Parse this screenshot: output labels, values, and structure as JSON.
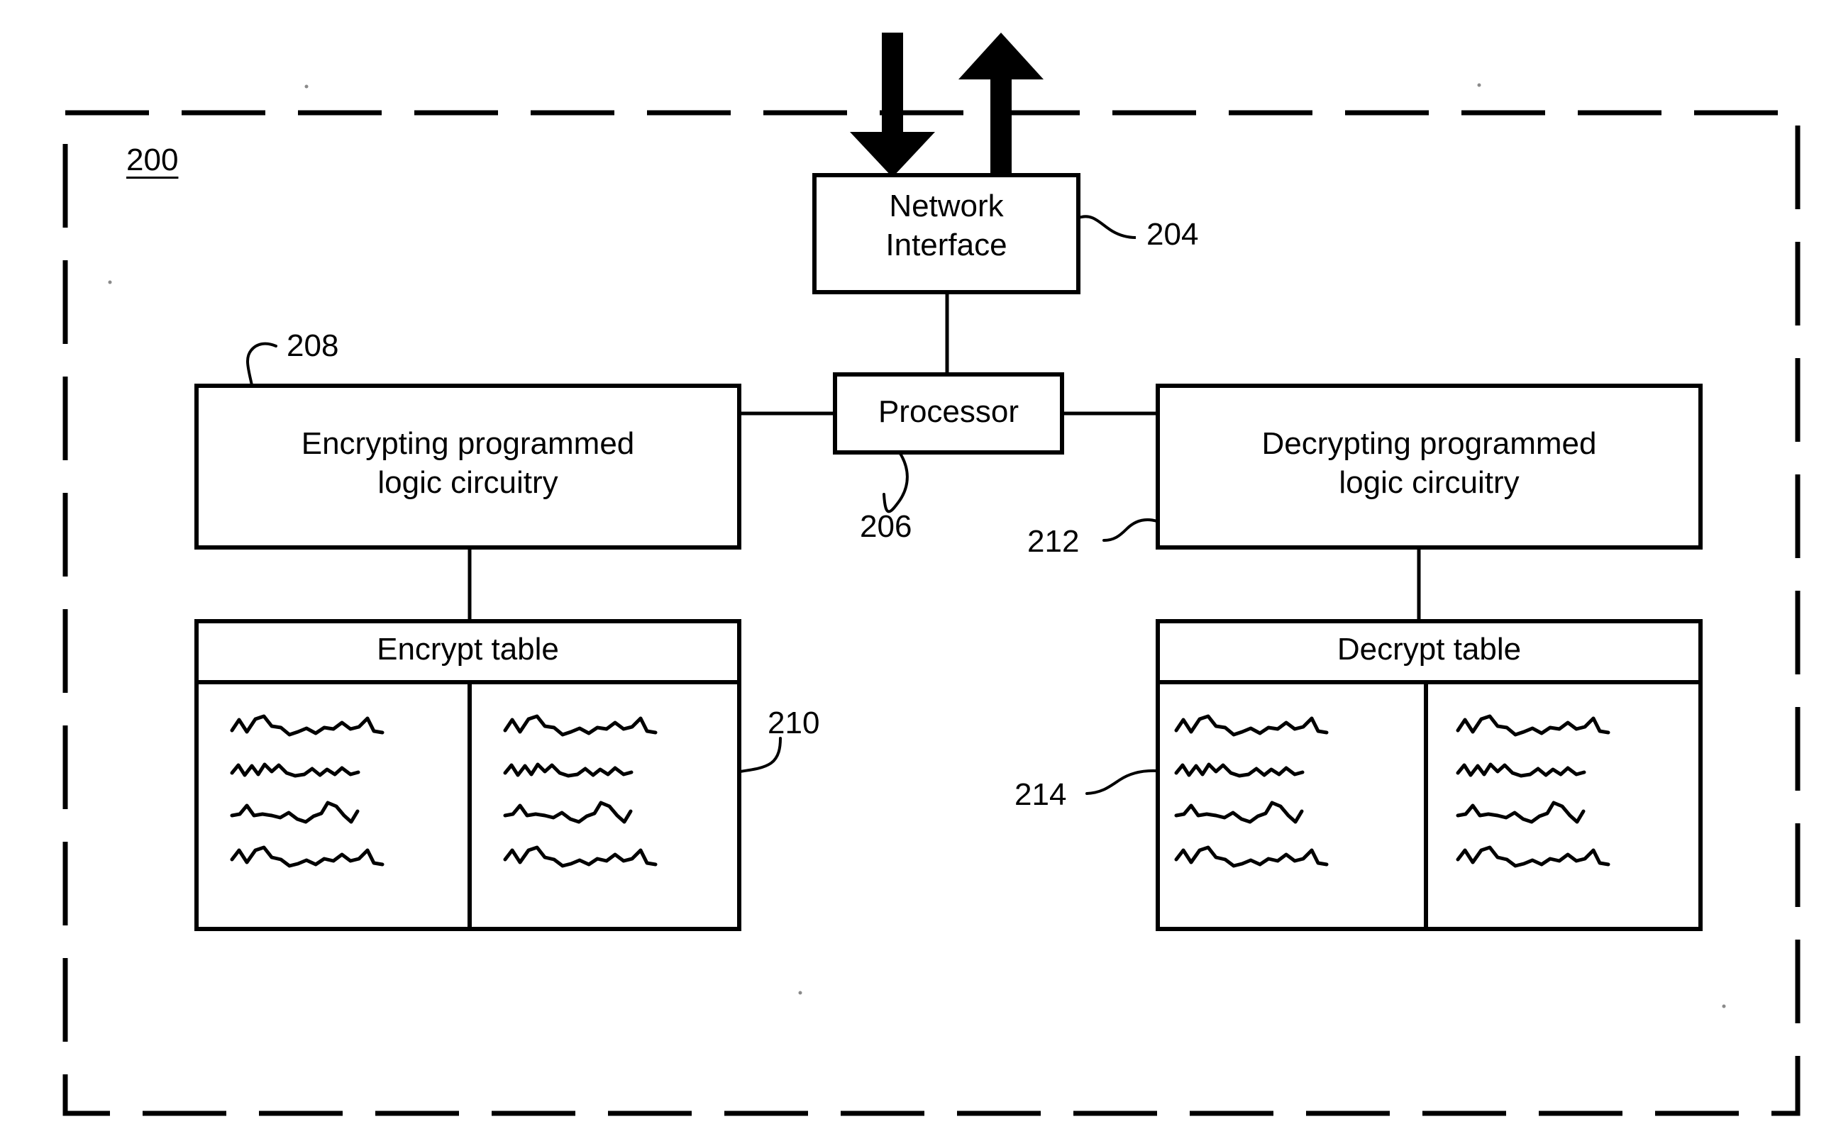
{
  "figure": {
    "name": "system-block-diagram",
    "system_label": "200",
    "enclosure_style": "dashed"
  },
  "blocks": {
    "network_interface": {
      "label": "Network\nInterface",
      "label_line1": "Network",
      "label_line2": "Interface",
      "ref": "204"
    },
    "processor": {
      "label": "Processor",
      "ref": "206"
    },
    "encrypting_logic": {
      "label_line1": "Encrypting programmed",
      "label_line2": "logic circuitry",
      "ref": "208"
    },
    "decrypting_logic": {
      "label_line1": "Decrypting programmed",
      "label_line2": "logic circuitry",
      "ref": "212"
    },
    "encrypt_table": {
      "label": "Encrypt table",
      "ref": "210",
      "columns": 2,
      "rows": 4
    },
    "decrypt_table": {
      "label": "Decrypt table",
      "ref": "214",
      "columns": 2,
      "rows": 4
    }
  },
  "arrows": {
    "inbound": {
      "name": "inbound-data-arrow",
      "direction": "down",
      "description": "incoming network data into Network Interface"
    },
    "outbound": {
      "name": "outbound-data-arrow",
      "direction": "up",
      "description": "outgoing network data from Network Interface"
    }
  },
  "connectors": [
    {
      "from": "network_interface",
      "to": "processor"
    },
    {
      "from": "processor",
      "to": "encrypting_logic"
    },
    {
      "from": "processor",
      "to": "decrypting_logic"
    },
    {
      "from": "encrypting_logic",
      "to": "encrypt_table"
    },
    {
      "from": "decrypting_logic",
      "to": "decrypt_table"
    }
  ],
  "colors": {
    "stroke": "#000000",
    "background": "#ffffff"
  }
}
